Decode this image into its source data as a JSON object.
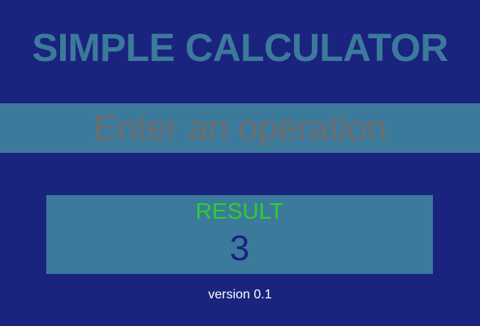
{
  "header": {
    "title": "SIMPLE CALCULATOR"
  },
  "input": {
    "value": "",
    "placeholder": "Enter an operation"
  },
  "result": {
    "label": "RESULT",
    "value": "3"
  },
  "footer": {
    "version": "version 0.1"
  },
  "colors": {
    "background": "#1a237e",
    "panel": "#3c7a9c",
    "title": "#3c7a9c",
    "result_label": "#2bd12b",
    "result_value": "#1a237e",
    "placeholder": "#6d6d6d",
    "version": "#ffffff"
  }
}
